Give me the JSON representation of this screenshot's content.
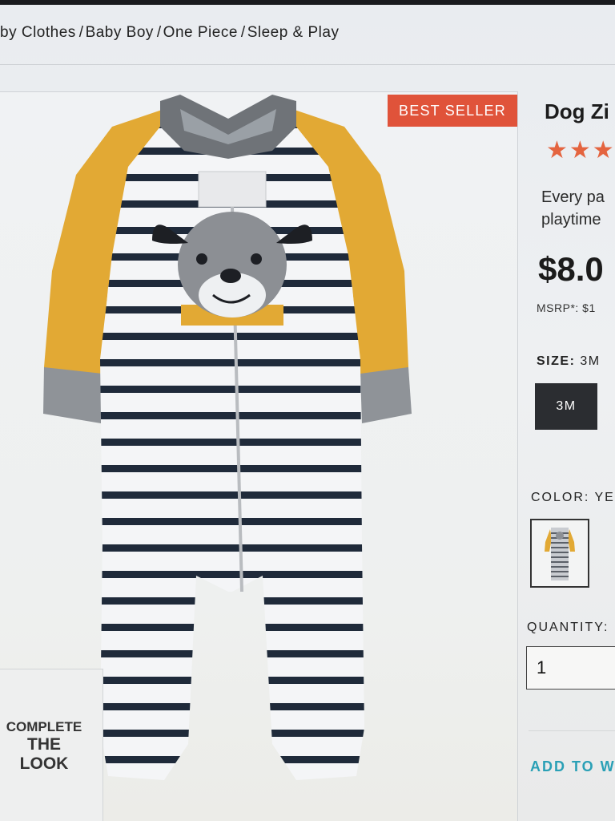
{
  "breadcrumb": {
    "items": [
      "by Clothes",
      "Baby Boy",
      "One Piece",
      "Sleep & Play"
    ],
    "separator": "/"
  },
  "product": {
    "badge": "BEST SELLER",
    "image_alt": "Dog zip-up sleep & play",
    "title": "Dog Zi",
    "stars": "★★★",
    "description_lines": [
      "Every pa",
      "playtime"
    ],
    "price": "$8.0",
    "msrp": "MSRP*: $1",
    "size_label": "SIZE:",
    "size_selected": "3M",
    "size_option": "3M",
    "color_label": "COLOR: YE",
    "quantity_label": "QUANTITY:",
    "quantity_value": "1",
    "wishlist_link": "ADD TO W"
  },
  "complete_the_look": {
    "line1": "COMPLETE",
    "line2": "THE",
    "line3": "LOOK"
  },
  "colors": {
    "badge_bg": "#e0533a",
    "star": "#e4643f",
    "link": "#2aa0b6",
    "size_button_bg": "#2b2d31",
    "onesie_sleeve": "#e2a934",
    "onesie_stripe": "#1f2a3a",
    "onesie_cuff": "#8f9398"
  }
}
